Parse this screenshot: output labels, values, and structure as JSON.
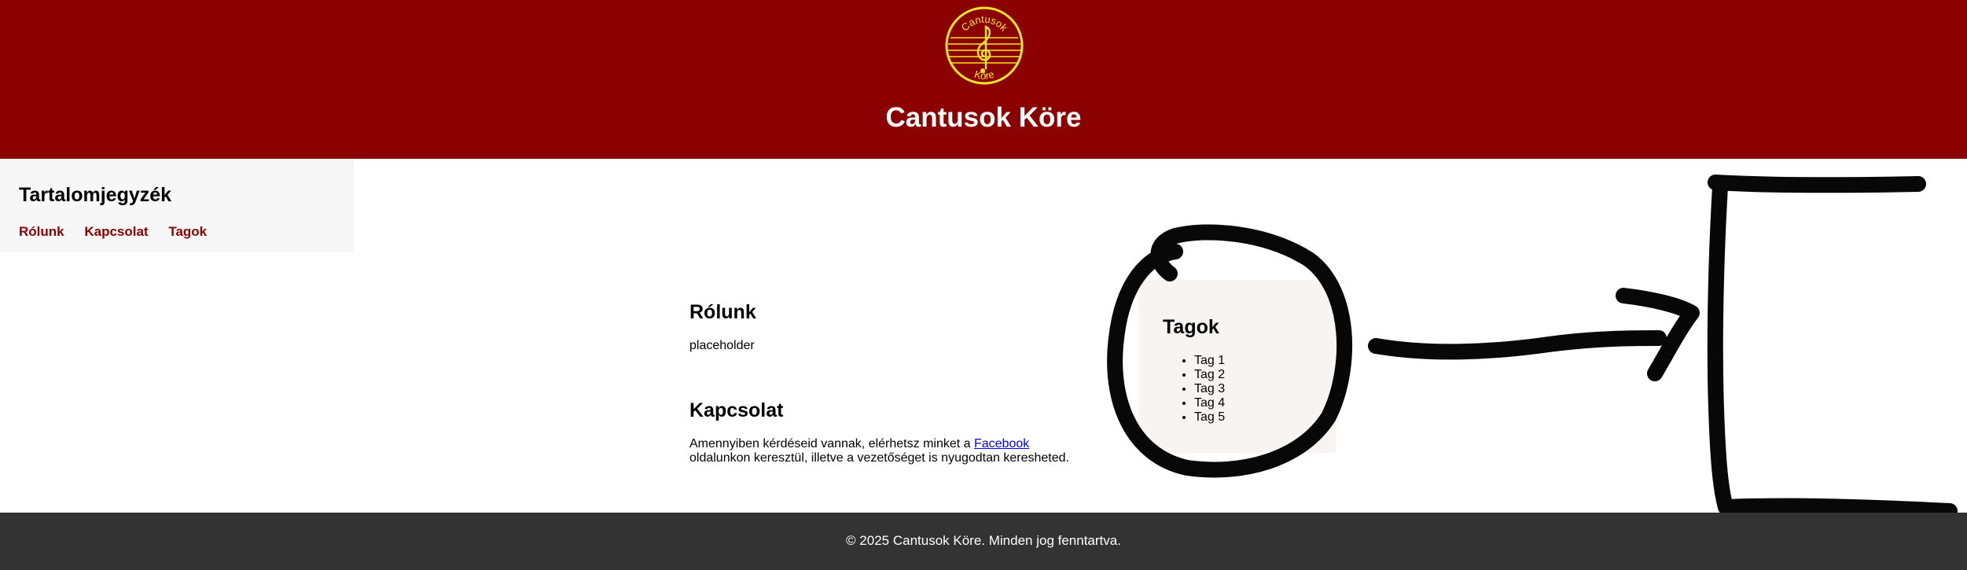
{
  "header": {
    "logo_text_top": "Cantusok",
    "logo_text_bottom": "Köre",
    "title": "Cantusok Köre"
  },
  "toc": {
    "title": "Tartalomjegyzék",
    "links": [
      "Rólunk",
      "Kapcsolat",
      "Tagok"
    ]
  },
  "about": {
    "title": "Rólunk",
    "text": "placeholder"
  },
  "contact": {
    "title": "Kapcsolat",
    "text_before": "Amennyiben kérdéseid vannak, elérhetsz minket a ",
    "link": "Facebook",
    "text_line2": "oldalunkon keresztül, illetve a vezetőséget is nyugodtan keresheted."
  },
  "members": {
    "title": "Tagok",
    "items": [
      "Tag 1",
      "Tag 2",
      "Tag 3",
      "Tag 4",
      "Tag 5"
    ]
  },
  "footer": {
    "text": "© 2025 Cantusok Köre. Minden jog fenntartva."
  },
  "colors": {
    "header_bg": "#8b0000",
    "logo_yellow": "#f5e62a",
    "link_red": "#8b0000",
    "footer_bg": "#333333"
  }
}
